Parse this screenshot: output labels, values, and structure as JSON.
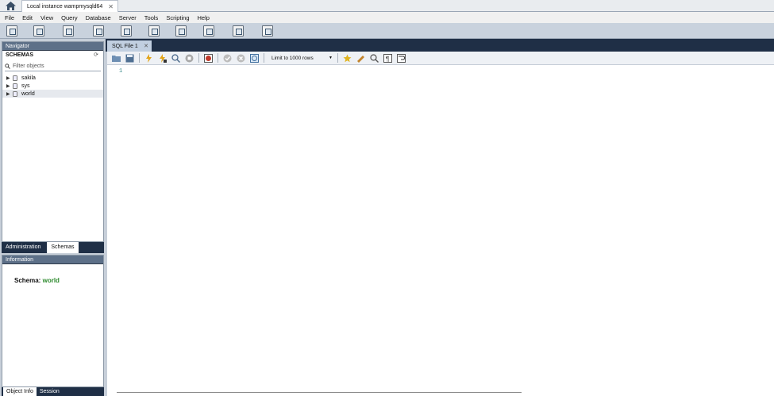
{
  "titlebar": {
    "connection_tab": "Local instance wampmysqld64",
    "close_glyph": "✕"
  },
  "menu": [
    "File",
    "Edit",
    "View",
    "Query",
    "Database",
    "Server",
    "Tools",
    "Scripting",
    "Help"
  ],
  "main_toolbar": {
    "icons": [
      "new-sql-tab-icon",
      "open-sql-script-icon",
      "info-icon",
      "create-schema-icon",
      "create-table-icon",
      "create-view-icon",
      "create-procedure-icon",
      "create-function-icon",
      "search-table-data-icon",
      "reconnect-icon"
    ],
    "right_icons": [
      "settings-gear-icon",
      "toggle-sidebar-icon",
      "toggle-output-icon",
      "toggle-secondary-sidebar-icon"
    ]
  },
  "navigator": {
    "title": "Navigator",
    "schemas_label": "SCHEMAS",
    "filter_placeholder": "Filter objects",
    "schemas": [
      {
        "name": "sakila",
        "selected": false
      },
      {
        "name": "sys",
        "selected": false
      },
      {
        "name": "world",
        "selected": true
      }
    ],
    "tabs": [
      "Administration",
      "Schemas"
    ],
    "active_tab": "Schemas"
  },
  "information": {
    "title": "Information",
    "schema_label": "Schema:",
    "schema_value": "world",
    "tabs": [
      "Object Info",
      "Session"
    ],
    "active_tab": "Object Info"
  },
  "editor": {
    "tab_label": "SQL File 1",
    "limit_label": "Limit to 1000 rows",
    "line_number": "1"
  },
  "colors": {
    "header_dark": "#1f2f46",
    "panel_head": "#5d7088",
    "schema_value": "#2d8a2d"
  }
}
